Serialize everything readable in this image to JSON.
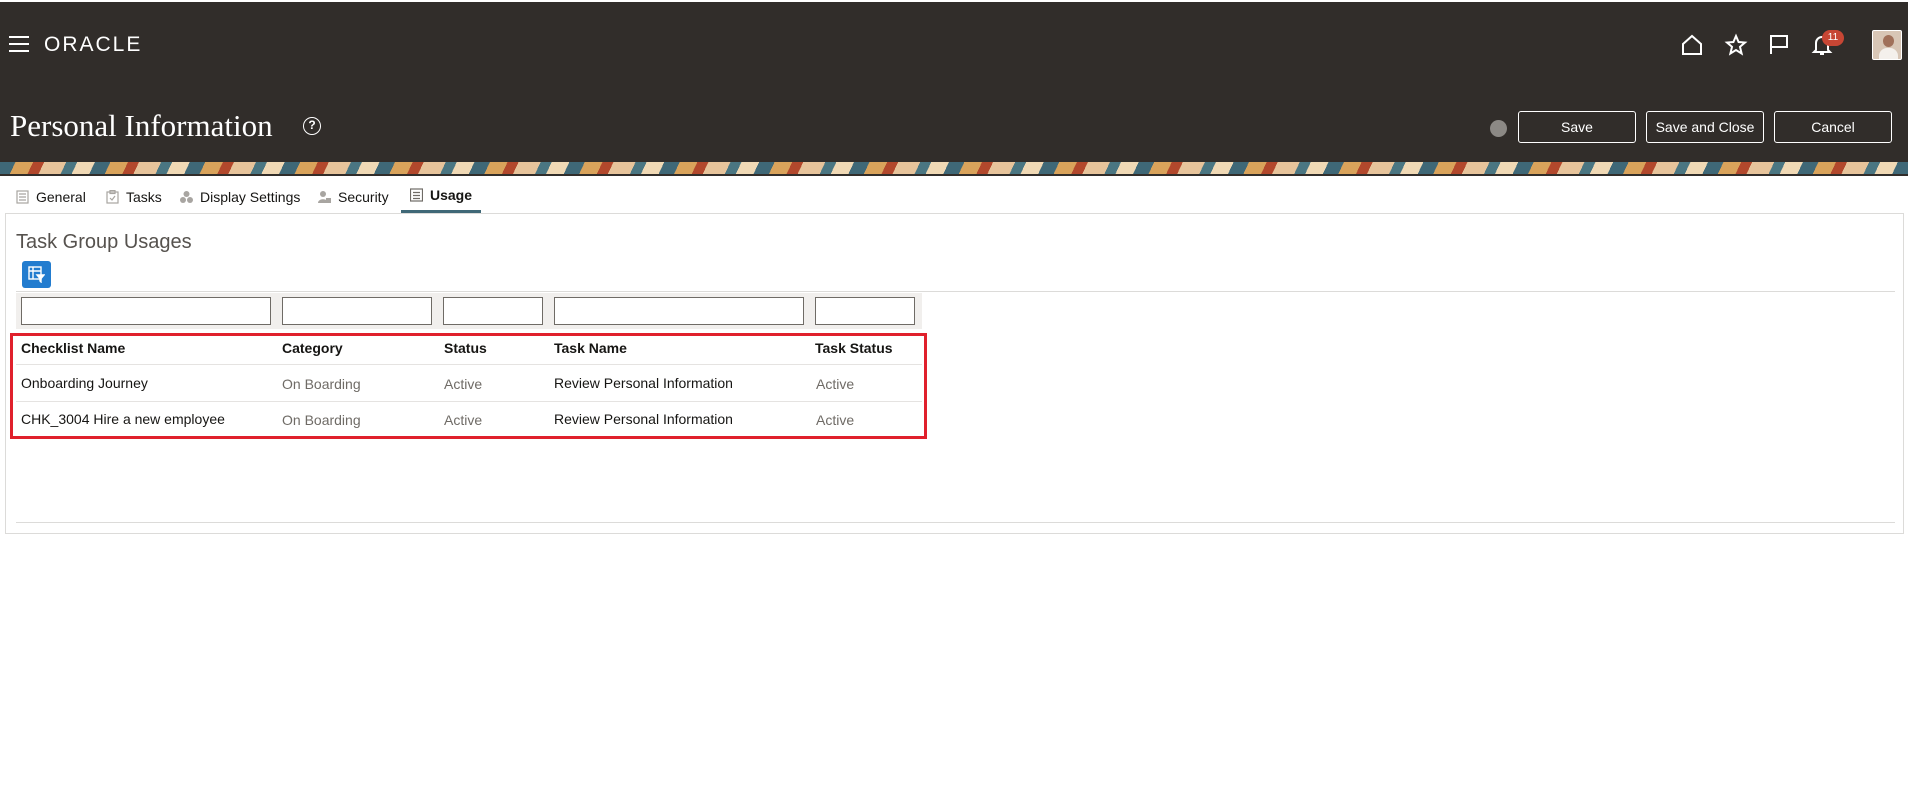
{
  "header": {
    "logo": "ORACLE",
    "notification_count": "11",
    "page_title": "Personal Information",
    "help_glyph": "?",
    "buttons": {
      "save": "Save",
      "save_and_close": "Save and Close",
      "cancel": "Cancel"
    },
    "icons": [
      "hamburger-menu-icon",
      "home-icon",
      "favorites-star-icon",
      "flag-icon",
      "notifications-bell-icon",
      "globe-icon",
      "help-icon"
    ],
    "colors": {
      "bar": "#312d2a",
      "badge": "#c74634",
      "accent": "#227ccf",
      "highlight": "#e0202c"
    }
  },
  "tabs": [
    {
      "label": "General",
      "icon": "document-icon"
    },
    {
      "label": "Tasks",
      "icon": "clipboard-icon"
    },
    {
      "label": "Display Settings",
      "icon": "display-settings-icon"
    },
    {
      "label": "Security",
      "icon": "security-icon"
    },
    {
      "label": "Usage",
      "icon": "usage-list-icon",
      "active": true
    }
  ],
  "usage": {
    "section_title": "Task Group Usages",
    "columns": [
      "Checklist Name",
      "Category",
      "Status",
      "Task Name",
      "Task Status"
    ],
    "filters": [
      "",
      "",
      "",
      "",
      ""
    ],
    "rows": [
      {
        "checklist_name": "Onboarding Journey",
        "category": "On Boarding",
        "status": "Active",
        "task_name": "Review Personal Information",
        "task_status": "Active"
      },
      {
        "checklist_name": "CHK_3004 Hire a new employee",
        "category": "On Boarding",
        "status": "Active",
        "task_name": "Review Personal Information",
        "task_status": "Active"
      }
    ]
  }
}
